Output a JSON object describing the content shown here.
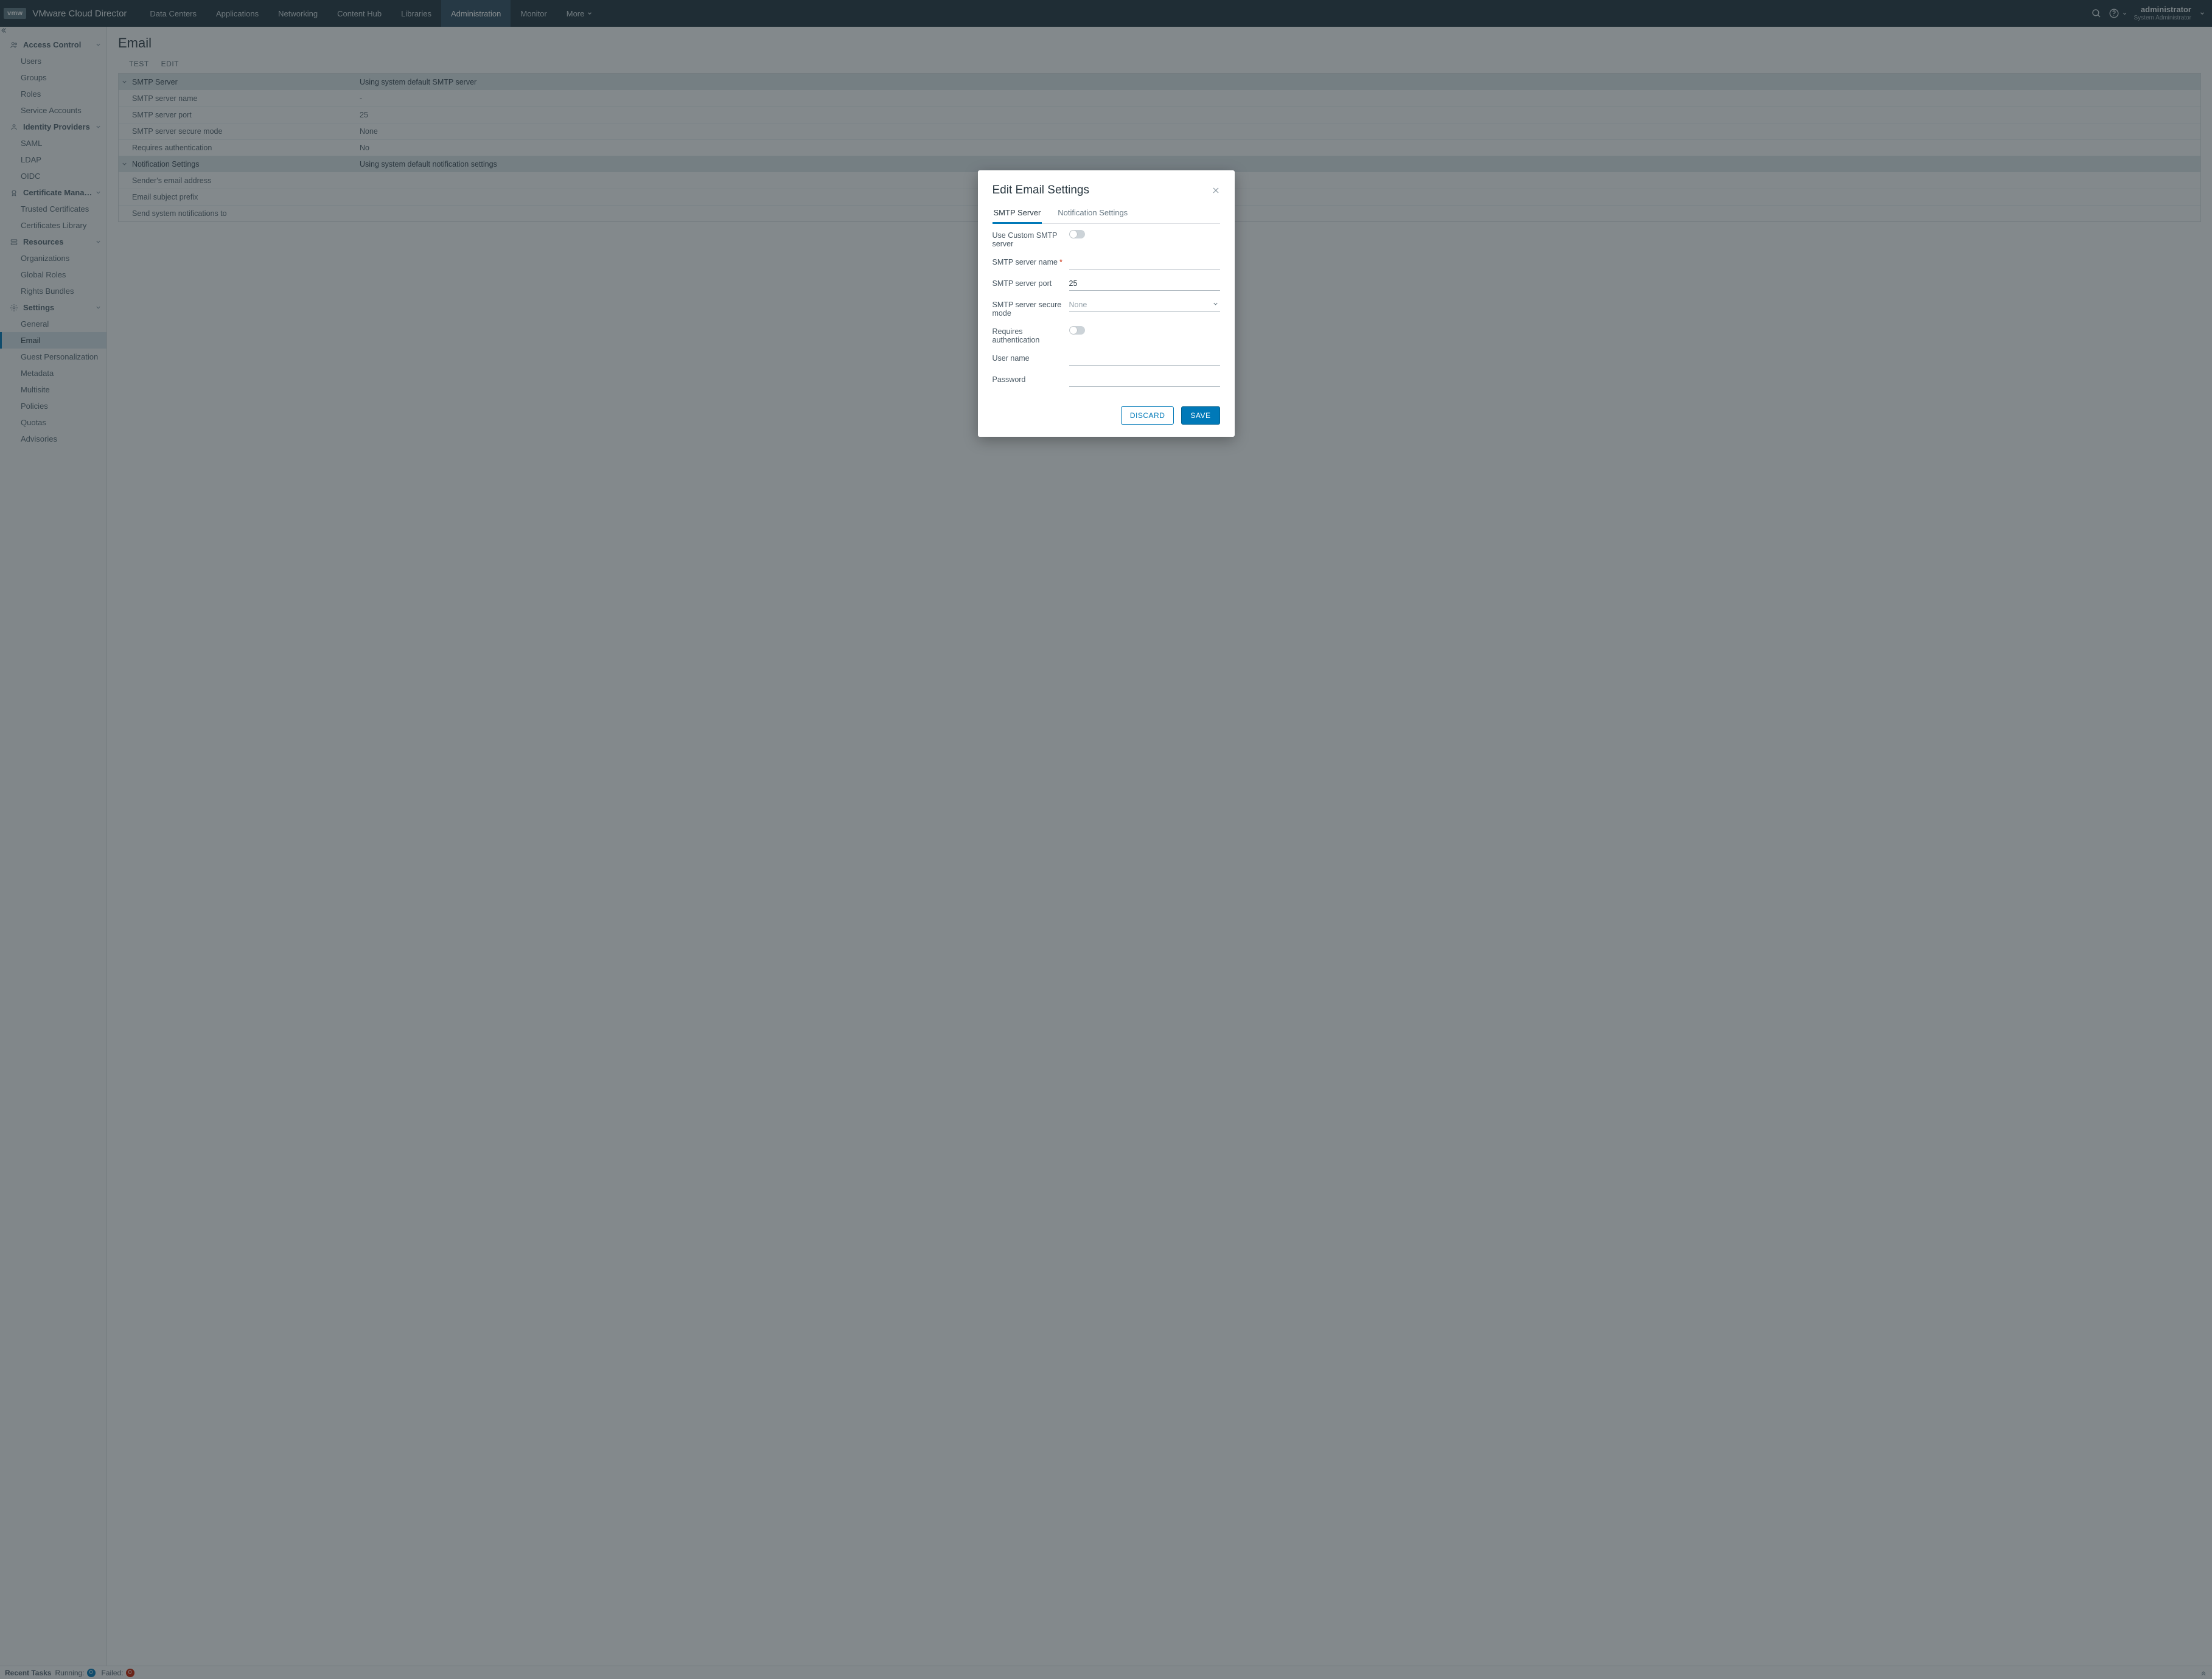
{
  "header": {
    "brand_badge": "vmw",
    "brand_title": "VMware Cloud Director",
    "nav": [
      {
        "label": "Data Centers",
        "active": false
      },
      {
        "label": "Applications",
        "active": false
      },
      {
        "label": "Networking",
        "active": false
      },
      {
        "label": "Content Hub",
        "active": false
      },
      {
        "label": "Libraries",
        "active": false
      },
      {
        "label": "Administration",
        "active": true
      },
      {
        "label": "Monitor",
        "active": false
      },
      {
        "label": "More",
        "active": false,
        "dropdown": true
      }
    ],
    "user": {
      "name": "administrator",
      "role": "System Administrator"
    }
  },
  "sidebar": {
    "sections": [
      {
        "icon": "users",
        "label": "Access Control",
        "items": [
          {
            "label": "Users"
          },
          {
            "label": "Groups"
          },
          {
            "label": "Roles"
          },
          {
            "label": "Service Accounts"
          }
        ]
      },
      {
        "icon": "id",
        "label": "Identity Providers",
        "items": [
          {
            "label": "SAML"
          },
          {
            "label": "LDAP"
          },
          {
            "label": "OIDC"
          }
        ]
      },
      {
        "icon": "cert",
        "label": "Certificate Managem…",
        "items": [
          {
            "label": "Trusted Certificates"
          },
          {
            "label": "Certificates Library"
          }
        ]
      },
      {
        "icon": "res",
        "label": "Resources",
        "items": [
          {
            "label": "Organizations"
          },
          {
            "label": "Global Roles"
          },
          {
            "label": "Rights Bundles"
          }
        ]
      },
      {
        "icon": "gear",
        "label": "Settings",
        "items": [
          {
            "label": "General"
          },
          {
            "label": "Email",
            "active": true
          },
          {
            "label": "Guest Personalization"
          },
          {
            "label": "Metadata"
          },
          {
            "label": "Multisite"
          },
          {
            "label": "Policies"
          },
          {
            "label": "Quotas"
          },
          {
            "label": "Advisories"
          }
        ]
      }
    ]
  },
  "page": {
    "title": "Email",
    "actions": [
      "TEST",
      "EDIT"
    ],
    "groups": [
      {
        "label": "SMTP Server",
        "summary": "Using system default SMTP server",
        "rows": [
          {
            "k": "SMTP server name",
            "v": "-"
          },
          {
            "k": "SMTP server port",
            "v": "25"
          },
          {
            "k": "SMTP server secure mode",
            "v": "None"
          },
          {
            "k": "Requires authentication",
            "v": "No"
          }
        ]
      },
      {
        "label": "Notification Settings",
        "summary": "Using system default notification settings",
        "rows": [
          {
            "k": "Sender's email address",
            "v": ""
          },
          {
            "k": "Email subject prefix",
            "v": ""
          },
          {
            "k": "Send system notifications to",
            "v": ""
          }
        ]
      }
    ]
  },
  "modal": {
    "title": "Edit Email Settings",
    "tabs": [
      {
        "label": "SMTP Server",
        "active": true
      },
      {
        "label": "Notification Settings",
        "active": false
      }
    ],
    "form": {
      "use_custom_label": "Use Custom SMTP server",
      "server_name_label": "SMTP server name",
      "server_port_label": "SMTP server port",
      "server_port_value": "25",
      "secure_mode_label": "SMTP server secure mode",
      "secure_mode_value": "None",
      "requires_auth_label": "Requires authentication",
      "username_label": "User name",
      "password_label": "Password"
    },
    "discard": "DISCARD",
    "save": "SAVE"
  },
  "footer": {
    "recent_label": "Recent Tasks",
    "running_label": "Running:",
    "running_count": "0",
    "failed_label": "Failed:",
    "failed_count": "0"
  }
}
